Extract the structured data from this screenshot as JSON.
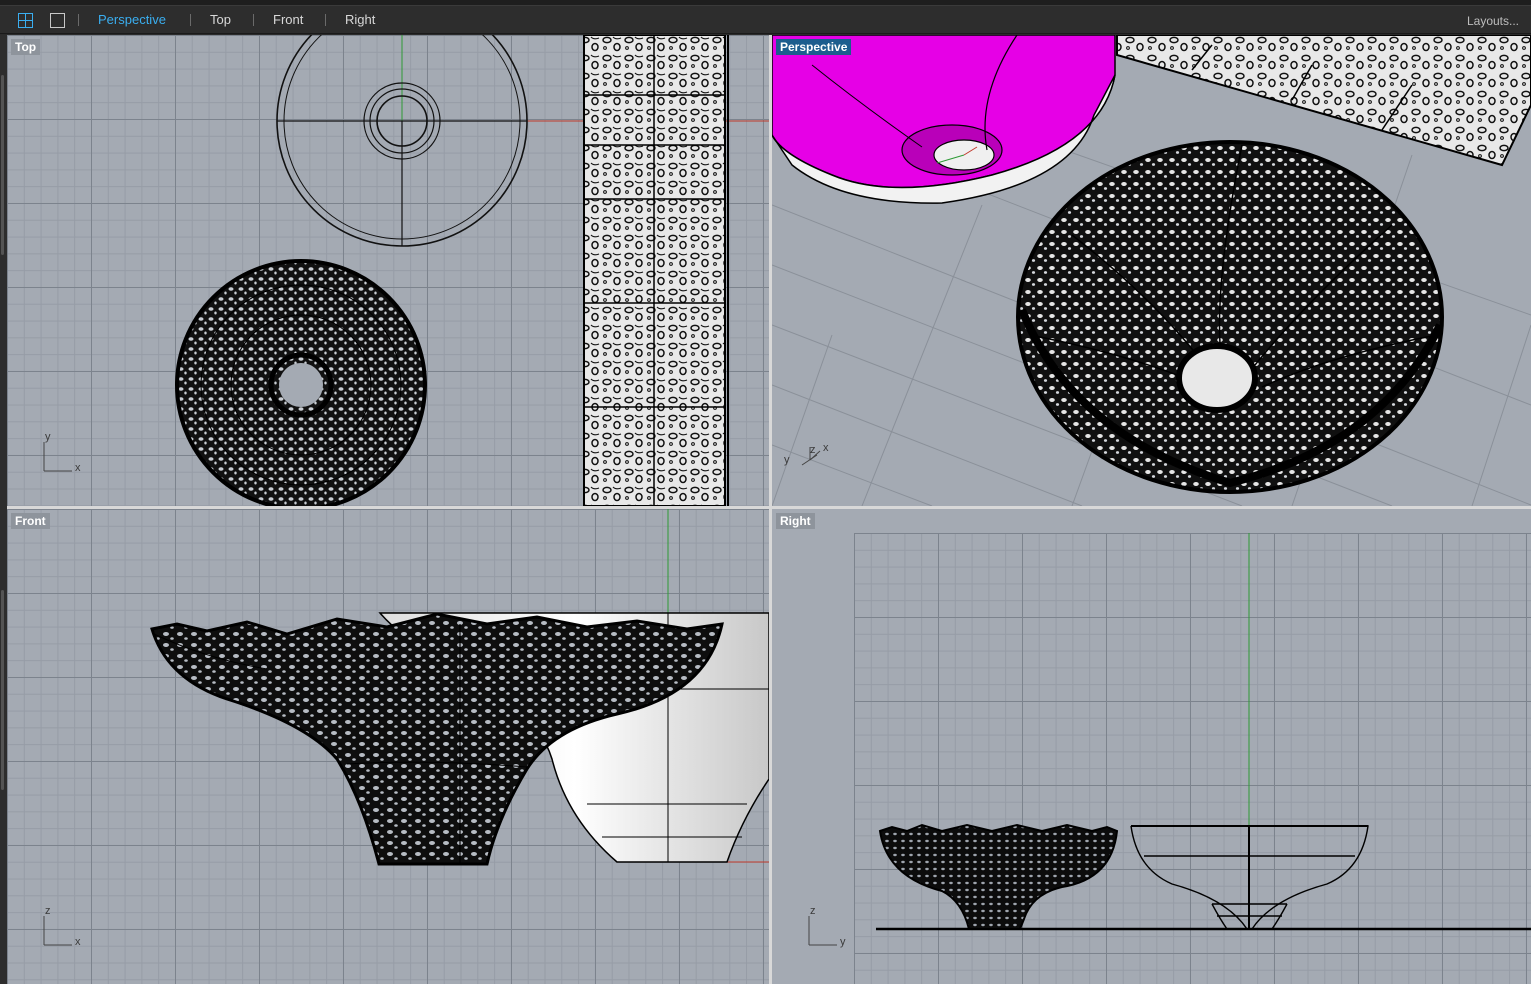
{
  "toolbar": {
    "tabs": [
      {
        "label": "Perspective",
        "active": true
      },
      {
        "label": "Top",
        "active": false
      },
      {
        "label": "Front",
        "active": false
      },
      {
        "label": "Right",
        "active": false
      }
    ],
    "layouts_label": "Layouts...",
    "icons": [
      "four-viewports-icon",
      "single-viewport-icon"
    ]
  },
  "viewports": {
    "top": {
      "label": "Top",
      "axis_a": "y",
      "axis_b": "x"
    },
    "perspective": {
      "label": "Perspective",
      "axis_a": "y",
      "axis_b": "z",
      "axis_c": "x"
    },
    "front": {
      "label": "Front",
      "axis_a": "z",
      "axis_b": "x"
    },
    "right": {
      "label": "Right",
      "axis_a": "z",
      "axis_b": "y"
    }
  },
  "colors": {
    "accent": "#3aaef0",
    "active_label_bg": "#1c5d8e",
    "viewport_bg": "#a4aab3",
    "x_axis": "#c0392b",
    "y_axis": "#2e9a36",
    "surface_highlight": "#e600e6"
  }
}
